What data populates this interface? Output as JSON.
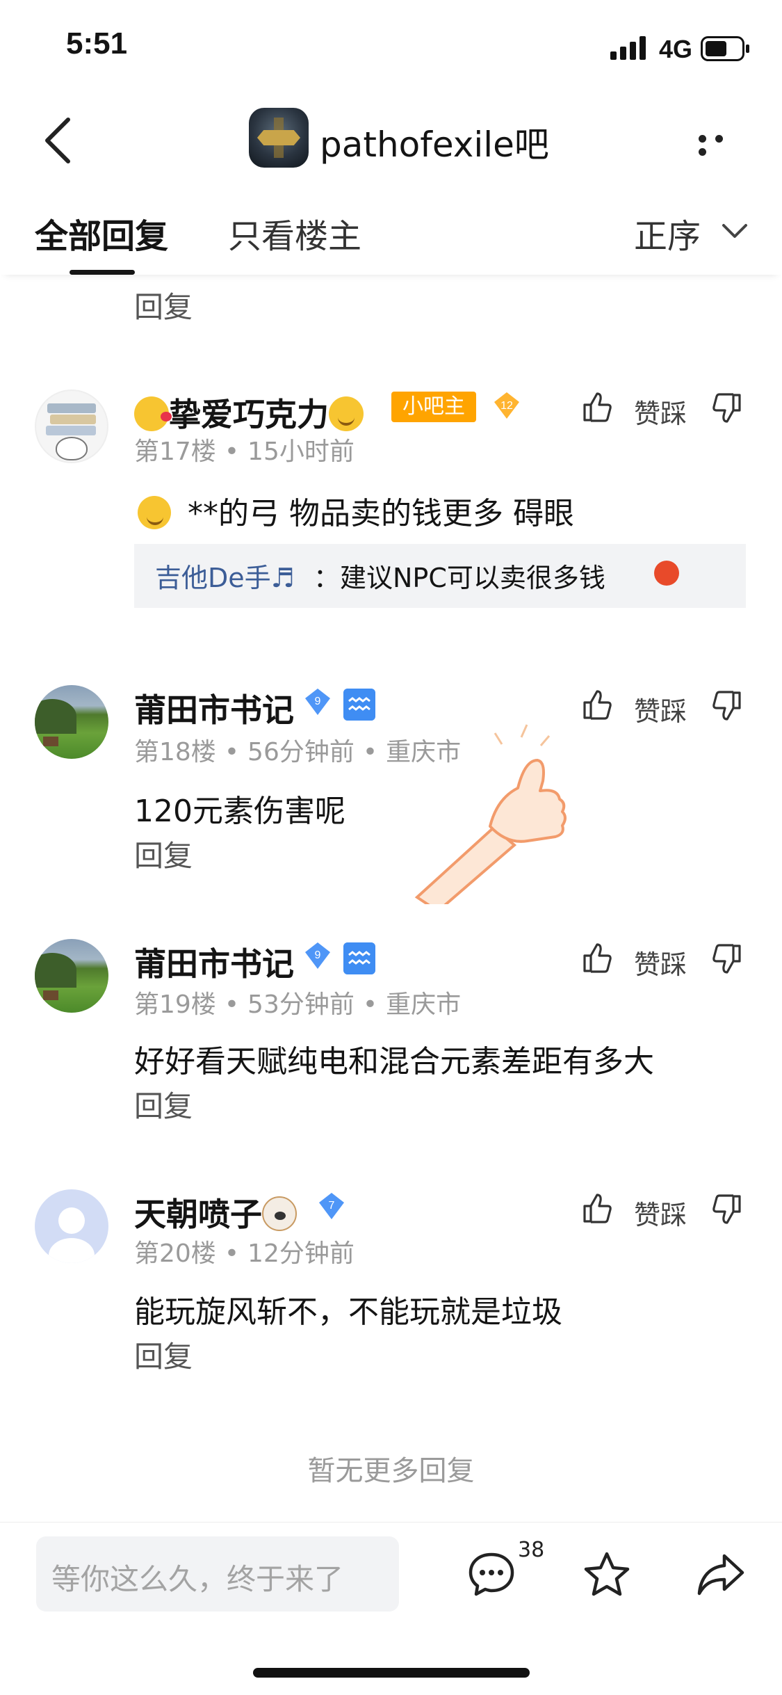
{
  "status_bar": {
    "time": "5:51",
    "network": "4G"
  },
  "header": {
    "forum_name": "pathofexile吧"
  },
  "tabs": {
    "all_replies": "全部回复",
    "owner_only": "只看楼主",
    "sort_label": "正序"
  },
  "top_reply_link": "回复",
  "posts": [
    {
      "name": "挚爱巧克力",
      "mod_badge": "小吧主",
      "level": "12",
      "floor": "第17楼",
      "time": "15小时前",
      "location": "",
      "like_label": "赞踩",
      "content": "**的弓 物品卖的钱更多 碍眼",
      "sub_reply": {
        "author": "吉他De手♬",
        "text": "：建议NPC可以卖很多钱"
      }
    },
    {
      "name": "莆田市书记",
      "level": "9",
      "floor": "第18楼",
      "time": "56分钟前",
      "location": "重庆市",
      "like_label": "赞踩",
      "content": "120元素伤害呢",
      "reply_link": "回复"
    },
    {
      "name": "莆田市书记",
      "level": "9",
      "floor": "第19楼",
      "time": "53分钟前",
      "location": "重庆市",
      "like_label": "赞踩",
      "content": "好好看天赋纯电和混合元素差距有多大",
      "reply_link": "回复"
    },
    {
      "name": "天朝喷子",
      "level": "7",
      "floor": "第20楼",
      "time": "12分钟前",
      "location": "",
      "like_label": "赞踩",
      "content": "能玩旋风斩不，不能玩就是垃圾",
      "reply_link": "回复"
    }
  ],
  "no_more": "暂无更多回复",
  "bottom_bar": {
    "input_placeholder": "等你这么久，终于来了",
    "comment_count": "38"
  },
  "colors": {
    "mod_badge": "#ffa400",
    "link_blue": "#3c5d97",
    "level_badge": "#4f96f7",
    "zodiac": "#3f8df3"
  }
}
